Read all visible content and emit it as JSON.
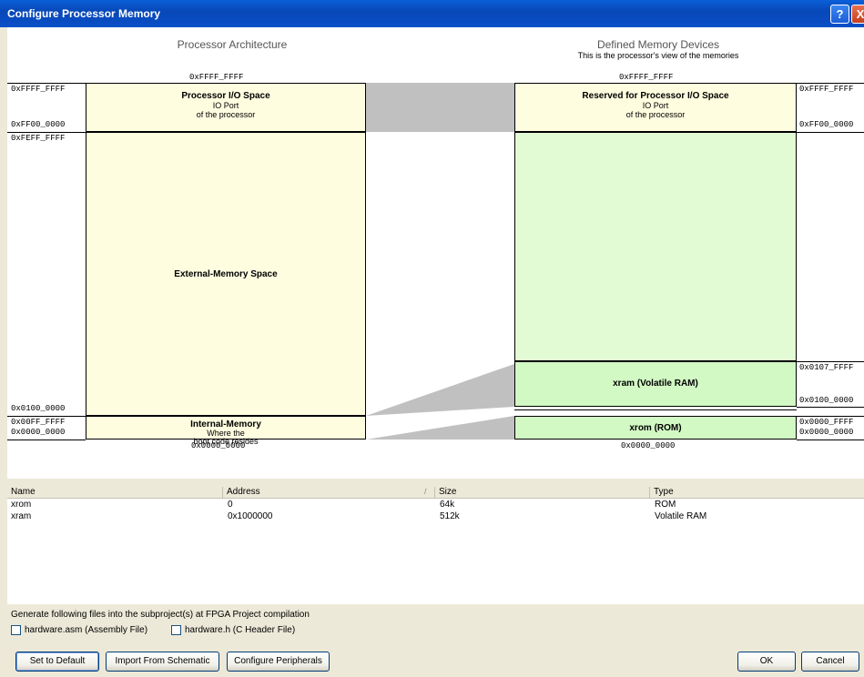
{
  "window": {
    "title": "Configure Processor Memory",
    "help": "?",
    "close": "X"
  },
  "diagram": {
    "left_heading": "Processor Architecture",
    "right_heading": "Defined Memory Devices",
    "right_subheading": "This is the processor's view of the memories",
    "left_top_addr": "0xFFFF_FFFF",
    "right_top_addr": "0xFFFF_FFFF",
    "left_bottom_addr": "0x0000_0000",
    "right_bottom_addr": "0x0000_0000",
    "left_blocks": {
      "io": {
        "title": "Processor I/O Space",
        "line1": "IO Port",
        "line2": "of the processor",
        "hi": "0xFFFF_FFFF",
        "lo": "0xFF00_0000"
      },
      "ext": {
        "title": "External-Memory Space",
        "hi": "0xFEFF_FFFF",
        "lo": "0x0100_0000"
      },
      "int": {
        "title": "Internal-Memory",
        "line1": "Where the",
        "line2": "boot code resides",
        "hi": "0x00FF_FFFF",
        "lo": "0x0000_0000"
      }
    },
    "right_blocks": {
      "io": {
        "title": "Reserved for Processor I/O Space",
        "line1": "IO Port",
        "line2": "of the processor",
        "hi": "0xFFFF_FFFF",
        "lo": "0xFF00_0000"
      },
      "xram": {
        "title": "xram (Volatile RAM)",
        "hi": "0x0107_FFFF",
        "lo": "0x0100_0000"
      },
      "xrom": {
        "title": "xrom (ROM)",
        "hi": "0x0000_FFFF",
        "lo": "0x0000_0000"
      }
    }
  },
  "table": {
    "headers": {
      "name": "Name",
      "address": "Address",
      "size": "Size",
      "type": "Type",
      "sort": "/"
    },
    "rows": [
      {
        "name": "xrom",
        "address": "0",
        "size": "64k",
        "type": "ROM"
      },
      {
        "name": "xram",
        "address": "0x1000000",
        "size": "512k",
        "type": "Volatile RAM"
      }
    ]
  },
  "generate": {
    "label": "Generate following files into the subproject(s) at FPGA Project compilation",
    "asm": "hardware.asm (Assembly File)",
    "header": "hardware.h (C Header File)"
  },
  "buttons": {
    "set_default": "Set to Default",
    "import": "Import From Schematic",
    "configure": "Configure Peripherals",
    "ok": "OK",
    "cancel": "Cancel"
  },
  "colors": {
    "title_bar": "#0a4fc8",
    "processor_block": "#fefde0",
    "memory_block": "#e3fbd4",
    "mapping": "#c0c0c0"
  }
}
